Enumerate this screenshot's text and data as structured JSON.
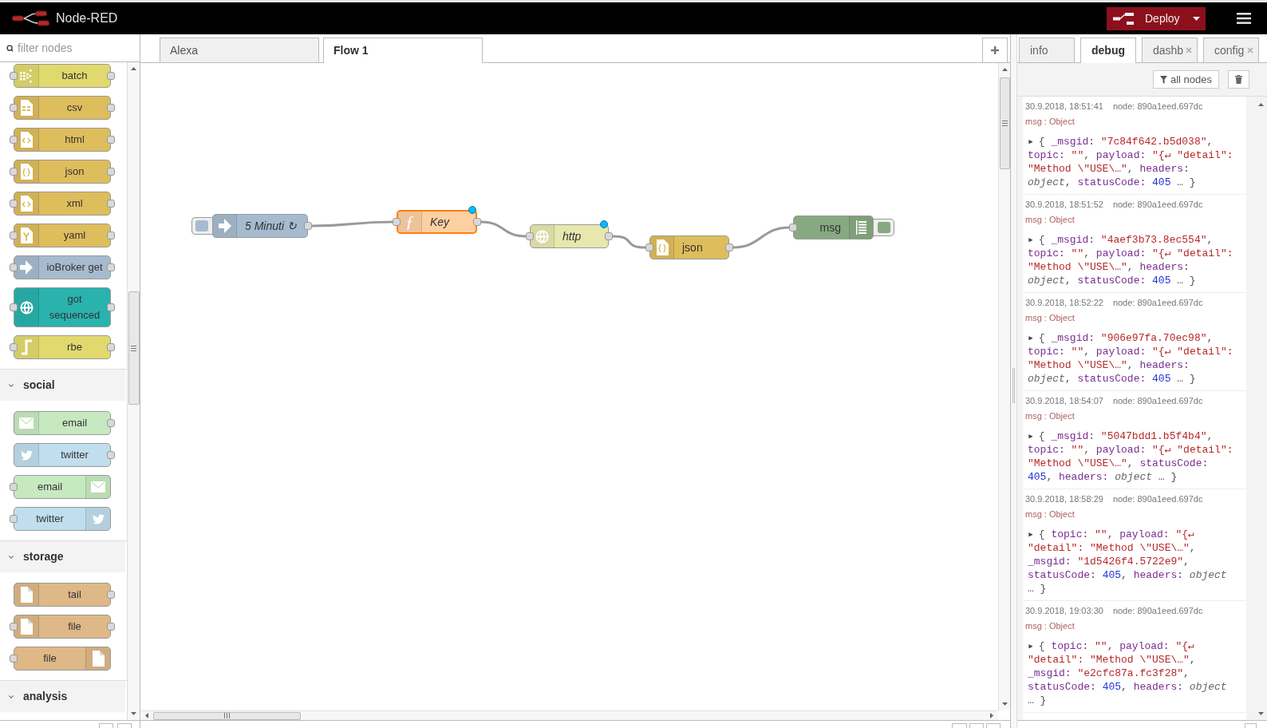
{
  "header": {
    "title": "Node-RED",
    "deploy": {
      "label": "Deploy"
    }
  },
  "palette": {
    "filter": {
      "placeholder": "filter nodes"
    },
    "sections": [
      {
        "nodes": [
          {
            "label": "batch",
            "kind": "batch",
            "color": "#e2d96e",
            "input": true,
            "output": true,
            "icon_right": false
          },
          {
            "label": "csv",
            "kind": "csv",
            "color": "#debd5c",
            "input": true,
            "output": true,
            "icon_right": false
          },
          {
            "label": "html",
            "kind": "html",
            "color": "#debd5c",
            "input": true,
            "output": true,
            "icon_right": false
          },
          {
            "label": "json",
            "kind": "json",
            "color": "#debd5c",
            "input": true,
            "output": true,
            "icon_right": false
          },
          {
            "label": "xml",
            "kind": "xml",
            "color": "#debd5c",
            "input": true,
            "output": true,
            "icon_right": false
          },
          {
            "label": "yaml",
            "kind": "yaml",
            "color": "#debd5c",
            "input": true,
            "output": true,
            "icon_right": false
          },
          {
            "label": "ioBroker get",
            "kind": "iobroker",
            "color": "#a6bbcf",
            "input": true,
            "output": true,
            "icon_right": false
          },
          {
            "label": "got sequenced",
            "kind": "globe",
            "color": "#2ab2ae",
            "input": true,
            "output": true,
            "icon_right": false
          },
          {
            "label": "rbe",
            "kind": "rbe",
            "color": "#e2d96e",
            "input": true,
            "output": true,
            "icon_right": false
          }
        ]
      },
      {
        "title": "social",
        "expanded": true,
        "nodes": [
          {
            "label": "email",
            "kind": "email",
            "color": "#c7e9c0",
            "input": false,
            "output": true,
            "icon_right": false
          },
          {
            "label": "twitter",
            "kind": "twitter",
            "color": "#c0deed",
            "input": false,
            "output": true,
            "icon_right": false
          },
          {
            "label": "email",
            "kind": "email",
            "color": "#c7e9c0",
            "input": true,
            "output": false,
            "icon_right": true
          },
          {
            "label": "twitter",
            "kind": "twitter",
            "color": "#c0deed",
            "input": true,
            "output": false,
            "icon_right": true
          }
        ]
      },
      {
        "title": "storage",
        "expanded": true,
        "nodes": [
          {
            "label": "tail",
            "kind": "file",
            "color": "#deb887",
            "input": false,
            "output": true,
            "icon_right": false
          },
          {
            "label": "file",
            "kind": "file",
            "color": "#deb887",
            "input": true,
            "output": true,
            "icon_right": false
          },
          {
            "label": "file",
            "kind": "file",
            "color": "#deb887",
            "input": true,
            "output": false,
            "icon_right": true
          }
        ]
      },
      {
        "title": "analysis",
        "expanded": true
      }
    ]
  },
  "workspace": {
    "tabs": [
      {
        "label": "Alexa",
        "selected": false
      },
      {
        "label": "Flow 1",
        "selected": true
      }
    ],
    "nodes": [
      {
        "label": "5 Minuti ↻",
        "kind": "inject",
        "color": "#a6bbcf",
        "italic": true,
        "selected": false,
        "changed": false,
        "input": false,
        "output": true,
        "linked": true,
        "icon_right": false
      },
      {
        "label": "Key",
        "kind": "function",
        "glyph": "ƒ",
        "color": "#fdd0a2",
        "italic": true,
        "selected": true,
        "changed": true,
        "input": true,
        "output": true,
        "linked": true,
        "icon_right": false
      },
      {
        "label": "http",
        "kind": "globe",
        "color": "#e7e7ae",
        "italic": true,
        "selected": false,
        "changed": true,
        "input": true,
        "output": true,
        "linked": true,
        "icon_right": false
      },
      {
        "label": "json",
        "kind": "json",
        "color": "#debd5c",
        "italic": false,
        "selected": false,
        "changed": false,
        "input": true,
        "output": true,
        "linked": true,
        "icon_right": false
      },
      {
        "label": "msg",
        "kind": "debug",
        "color": "#87a980",
        "italic": false,
        "selected": false,
        "changed": false,
        "input": true,
        "output": false,
        "icon_right": true
      }
    ]
  },
  "sidebar": {
    "tabs": [
      {
        "label": "info",
        "selected": false,
        "closable": false
      },
      {
        "label": "debug",
        "selected": true,
        "closable": false
      },
      {
        "label": "dashb",
        "selected": false,
        "closable": true
      },
      {
        "label": "config",
        "selected": false,
        "closable": true
      }
    ],
    "filter": {
      "label": "all nodes"
    },
    "messages": [
      {
        "time": "30.9.2018, 18:51:41",
        "node": "node: 890a1eed.697dc",
        "type": "msg : Object",
        "tokens": [
          {
            "kind": "toggle",
            "text": "▸"
          },
          {
            "kind": "punct",
            "text": "{ "
          },
          {
            "kind": "key",
            "text": "_msgid: "
          },
          {
            "kind": "string",
            "text": "\"7c84f642.b5d038\""
          },
          {
            "kind": "punct",
            "text": ", "
          },
          {
            "kind": "key",
            "text": "topic: "
          },
          {
            "kind": "string",
            "text": "\"\""
          },
          {
            "kind": "punct",
            "text": ", "
          },
          {
            "kind": "key",
            "text": "payload: "
          },
          {
            "kind": "string",
            "text": "\"{↵ \"detail\": \"Method \\\"USE\\…\""
          },
          {
            "kind": "punct",
            "text": ", "
          },
          {
            "kind": "key",
            "text": "headers: "
          },
          {
            "kind": "meta",
            "text": "object"
          },
          {
            "kind": "punct",
            "text": ", "
          },
          {
            "kind": "key",
            "text": "statusCode: "
          },
          {
            "kind": "number",
            "text": "405"
          },
          {
            "kind": "punct",
            "text": " … }"
          }
        ]
      },
      {
        "time": "30.9.2018, 18:51:52",
        "node": "node: 890a1eed.697dc",
        "type": "msg : Object",
        "tokens": [
          {
            "kind": "toggle",
            "text": "▸"
          },
          {
            "kind": "punct",
            "text": "{ "
          },
          {
            "kind": "key",
            "text": "_msgid: "
          },
          {
            "kind": "string",
            "text": "\"4aef3b73.8ec554\""
          },
          {
            "kind": "punct",
            "text": ", "
          },
          {
            "kind": "key",
            "text": "topic: "
          },
          {
            "kind": "string",
            "text": "\"\""
          },
          {
            "kind": "punct",
            "text": ", "
          },
          {
            "kind": "key",
            "text": "payload: "
          },
          {
            "kind": "string",
            "text": "\"{↵ \"detail\": \"Method \\\"USE\\…\""
          },
          {
            "kind": "punct",
            "text": ", "
          },
          {
            "kind": "key",
            "text": "headers: "
          },
          {
            "kind": "meta",
            "text": "object"
          },
          {
            "kind": "punct",
            "text": ", "
          },
          {
            "kind": "key",
            "text": "statusCode: "
          },
          {
            "kind": "number",
            "text": "405"
          },
          {
            "kind": "punct",
            "text": " … }"
          }
        ]
      },
      {
        "time": "30.9.2018, 18:52:22",
        "node": "node: 890a1eed.697dc",
        "type": "msg : Object",
        "tokens": [
          {
            "kind": "toggle",
            "text": "▸"
          },
          {
            "kind": "punct",
            "text": "{ "
          },
          {
            "kind": "key",
            "text": "_msgid: "
          },
          {
            "kind": "string",
            "text": "\"906e97fa.70ec98\""
          },
          {
            "kind": "punct",
            "text": ", "
          },
          {
            "kind": "key",
            "text": "topic: "
          },
          {
            "kind": "string",
            "text": "\"\""
          },
          {
            "kind": "punct",
            "text": ", "
          },
          {
            "kind": "key",
            "text": "payload: "
          },
          {
            "kind": "string",
            "text": "\"{↵ \"detail\": \"Method \\\"USE\\…\""
          },
          {
            "kind": "punct",
            "text": ", "
          },
          {
            "kind": "key",
            "text": "headers: "
          },
          {
            "kind": "meta",
            "text": "object"
          },
          {
            "kind": "punct",
            "text": ", "
          },
          {
            "kind": "key",
            "text": "statusCode: "
          },
          {
            "kind": "number",
            "text": "405"
          },
          {
            "kind": "punct",
            "text": " … }"
          }
        ]
      },
      {
        "time": "30.9.2018, 18:54:07",
        "node": "node: 890a1eed.697dc",
        "type": "msg : Object",
        "tokens": [
          {
            "kind": "toggle",
            "text": "▸"
          },
          {
            "kind": "punct",
            "text": "{ "
          },
          {
            "kind": "key",
            "text": "_msgid: "
          },
          {
            "kind": "string",
            "text": "\"5047bdd1.b5f4b4\""
          },
          {
            "kind": "punct",
            "text": ", "
          },
          {
            "kind": "key",
            "text": "topic: "
          },
          {
            "kind": "string",
            "text": "\"\""
          },
          {
            "kind": "punct",
            "text": ", "
          },
          {
            "kind": "key",
            "text": "payload: "
          },
          {
            "kind": "string",
            "text": "\"{↵ \"detail\": \"Method \\\"USE\\…\""
          },
          {
            "kind": "punct",
            "text": ", "
          },
          {
            "kind": "key",
            "text": "statusCode: "
          },
          {
            "kind": "number",
            "text": "405"
          },
          {
            "kind": "punct",
            "text": ", "
          },
          {
            "kind": "key",
            "text": "headers: "
          },
          {
            "kind": "meta",
            "text": "object"
          },
          {
            "kind": "punct",
            "text": " … }"
          }
        ]
      },
      {
        "time": "30.9.2018, 18:58:29",
        "node": "node: 890a1eed.697dc",
        "type": "msg : Object",
        "tokens": [
          {
            "kind": "toggle",
            "text": "▸"
          },
          {
            "kind": "punct",
            "text": "{ "
          },
          {
            "kind": "key",
            "text": "topic: "
          },
          {
            "kind": "string",
            "text": "\"\""
          },
          {
            "kind": "punct",
            "text": ", "
          },
          {
            "kind": "key",
            "text": "payload: "
          },
          {
            "kind": "string",
            "text": "\"{↵ \"detail\": \"Method \\\"USE\\…\""
          },
          {
            "kind": "punct",
            "text": ", "
          },
          {
            "kind": "key",
            "text": "_msgid: "
          },
          {
            "kind": "string",
            "text": "\"1d5426f4.5722e9\""
          },
          {
            "kind": "punct",
            "text": ", "
          },
          {
            "kind": "key",
            "text": "statusCode: "
          },
          {
            "kind": "number",
            "text": "405"
          },
          {
            "kind": "punct",
            "text": ", "
          },
          {
            "kind": "key",
            "text": "headers: "
          },
          {
            "kind": "meta",
            "text": "object"
          },
          {
            "kind": "punct",
            "text": " … }"
          }
        ]
      },
      {
        "time": "30.9.2018, 19:03:30",
        "node": "node: 890a1eed.697dc",
        "type": "msg : Object",
        "tokens": [
          {
            "kind": "toggle",
            "text": "▸"
          },
          {
            "kind": "punct",
            "text": "{ "
          },
          {
            "kind": "key",
            "text": "topic: "
          },
          {
            "kind": "string",
            "text": "\"\""
          },
          {
            "kind": "punct",
            "text": ", "
          },
          {
            "kind": "key",
            "text": "payload: "
          },
          {
            "kind": "string",
            "text": "\"{↵ \"detail\": \"Method \\\"USE\\…\""
          },
          {
            "kind": "punct",
            "text": ", "
          },
          {
            "kind": "key",
            "text": "_msgid: "
          },
          {
            "kind": "string",
            "text": "\"e2cfc87a.fc3f28\""
          },
          {
            "kind": "punct",
            "text": ", "
          },
          {
            "kind": "key",
            "text": "statusCode: "
          },
          {
            "kind": "number",
            "text": "405"
          },
          {
            "kind": "punct",
            "text": ", "
          },
          {
            "kind": "key",
            "text": "headers: "
          },
          {
            "kind": "meta",
            "text": "object"
          },
          {
            "kind": "punct",
            "text": " … }"
          }
        ]
      }
    ]
  }
}
